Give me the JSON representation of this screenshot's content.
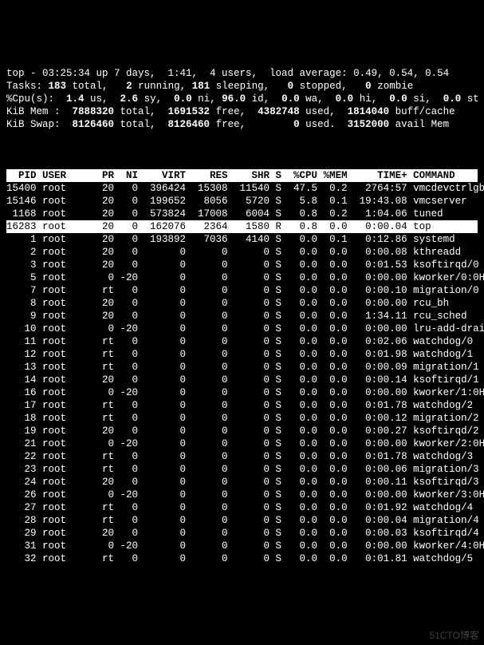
{
  "summary": {
    "line1_a": "top - 03:25:34 up 7 days,  1:41,  4 users,  load average: 0.49, 0.54, 0.54",
    "tasks_label": "Tasks:",
    "tasks_total": "183",
    "tasks_total_lbl": " total,   ",
    "tasks_running": "2",
    "tasks_running_lbl": " running, ",
    "tasks_sleeping": "181",
    "tasks_sleeping_lbl": " sleeping,   ",
    "tasks_stopped": "0",
    "tasks_stopped_lbl": " stopped,   ",
    "tasks_zombie": "0",
    "tasks_zombie_lbl": " zombie",
    "cpu_label": "%Cpu(s):  ",
    "cpu_us": "1.4",
    "cpu_us_lbl": " us,  ",
    "cpu_sy": "2.6",
    "cpu_sy_lbl": " sy,  ",
    "cpu_ni": "0.0",
    "cpu_ni_lbl": " ni, ",
    "cpu_id": "96.0",
    "cpu_id_lbl": " id,  ",
    "cpu_wa": "0.0",
    "cpu_wa_lbl": " wa,  ",
    "cpu_hi": "0.0",
    "cpu_hi_lbl": " hi,  ",
    "cpu_si": "0.0",
    "cpu_si_lbl": " si,  ",
    "cpu_st": "0.0",
    "cpu_st_lbl": " st",
    "mem_label": "KiB Mem :  ",
    "mem_total": "7888320",
    "mem_total_lbl": " total,  ",
    "mem_free": "1691532",
    "mem_free_lbl": " free,  ",
    "mem_used": "4382748",
    "mem_used_lbl": " used,  ",
    "mem_buff": "1814040",
    "mem_buff_lbl": " buff/cache",
    "swap_label": "KiB Swap:  ",
    "swap_total": "8126460",
    "swap_total_lbl": " total,  ",
    "swap_free": "8126460",
    "swap_free_lbl": " free,        ",
    "swap_used": "0",
    "swap_used_lbl": " used.  ",
    "swap_avail": "3152000",
    "swap_avail_lbl": " avail Mem"
  },
  "columns": "  PID USER      PR  NI    VIRT    RES    SHR S  %CPU %MEM     TIME+ COMMAND    ",
  "processes": [
    {
      "pid": "15400",
      "user": "root",
      "pr": "20",
      "ni": "0",
      "virt": "396424",
      "res": "15308",
      "shr": "11540",
      "s": "S",
      "cpu": "47.5",
      "mem": "0.2",
      "time": "2764:57",
      "cmd": "vmcdevctrlgb",
      "hl": false
    },
    {
      "pid": "15146",
      "user": "root",
      "pr": "20",
      "ni": "0",
      "virt": "199652",
      "res": "8056",
      "shr": "5720",
      "s": "S",
      "cpu": "5.8",
      "mem": "0.1",
      "time": "19:43.08",
      "cmd": "vmcserver",
      "hl": false
    },
    {
      "pid": "1168",
      "user": "root",
      "pr": "20",
      "ni": "0",
      "virt": "573824",
      "res": "17008",
      "shr": "6004",
      "s": "S",
      "cpu": "0.8",
      "mem": "0.2",
      "time": "1:04.06",
      "cmd": "tuned",
      "hl": false
    },
    {
      "pid": "16283",
      "user": "root",
      "pr": "20",
      "ni": "0",
      "virt": "162076",
      "res": "2364",
      "shr": "1580",
      "s": "R",
      "cpu": "0.8",
      "mem": "0.0",
      "time": "0:00.04",
      "cmd": "top",
      "hl": true
    },
    {
      "pid": "1",
      "user": "root",
      "pr": "20",
      "ni": "0",
      "virt": "193892",
      "res": "7036",
      "shr": "4140",
      "s": "S",
      "cpu": "0.0",
      "mem": "0.1",
      "time": "0:12.86",
      "cmd": "systemd",
      "hl": false
    },
    {
      "pid": "2",
      "user": "root",
      "pr": "20",
      "ni": "0",
      "virt": "0",
      "res": "0",
      "shr": "0",
      "s": "S",
      "cpu": "0.0",
      "mem": "0.0",
      "time": "0:00.08",
      "cmd": "kthreadd",
      "hl": false
    },
    {
      "pid": "3",
      "user": "root",
      "pr": "20",
      "ni": "0",
      "virt": "0",
      "res": "0",
      "shr": "0",
      "s": "S",
      "cpu": "0.0",
      "mem": "0.0",
      "time": "0:01.53",
      "cmd": "ksoftirqd/0",
      "hl": false
    },
    {
      "pid": "5",
      "user": "root",
      "pr": "0",
      "ni": "-20",
      "virt": "0",
      "res": "0",
      "shr": "0",
      "s": "S",
      "cpu": "0.0",
      "mem": "0.0",
      "time": "0:00.00",
      "cmd": "kworker/0:0H",
      "hl": false
    },
    {
      "pid": "7",
      "user": "root",
      "pr": "rt",
      "ni": "0",
      "virt": "0",
      "res": "0",
      "shr": "0",
      "s": "S",
      "cpu": "0.0",
      "mem": "0.0",
      "time": "0:00.10",
      "cmd": "migration/0",
      "hl": false
    },
    {
      "pid": "8",
      "user": "root",
      "pr": "20",
      "ni": "0",
      "virt": "0",
      "res": "0",
      "shr": "0",
      "s": "S",
      "cpu": "0.0",
      "mem": "0.0",
      "time": "0:00.00",
      "cmd": "rcu_bh",
      "hl": false
    },
    {
      "pid": "9",
      "user": "root",
      "pr": "20",
      "ni": "0",
      "virt": "0",
      "res": "0",
      "shr": "0",
      "s": "S",
      "cpu": "0.0",
      "mem": "0.0",
      "time": "1:34.11",
      "cmd": "rcu_sched",
      "hl": false
    },
    {
      "pid": "10",
      "user": "root",
      "pr": "0",
      "ni": "-20",
      "virt": "0",
      "res": "0",
      "shr": "0",
      "s": "S",
      "cpu": "0.0",
      "mem": "0.0",
      "time": "0:00.00",
      "cmd": "lru-add-drain",
      "hl": false
    },
    {
      "pid": "11",
      "user": "root",
      "pr": "rt",
      "ni": "0",
      "virt": "0",
      "res": "0",
      "shr": "0",
      "s": "S",
      "cpu": "0.0",
      "mem": "0.0",
      "time": "0:02.06",
      "cmd": "watchdog/0",
      "hl": false
    },
    {
      "pid": "12",
      "user": "root",
      "pr": "rt",
      "ni": "0",
      "virt": "0",
      "res": "0",
      "shr": "0",
      "s": "S",
      "cpu": "0.0",
      "mem": "0.0",
      "time": "0:01.98",
      "cmd": "watchdog/1",
      "hl": false
    },
    {
      "pid": "13",
      "user": "root",
      "pr": "rt",
      "ni": "0",
      "virt": "0",
      "res": "0",
      "shr": "0",
      "s": "S",
      "cpu": "0.0",
      "mem": "0.0",
      "time": "0:00.09",
      "cmd": "migration/1",
      "hl": false
    },
    {
      "pid": "14",
      "user": "root",
      "pr": "20",
      "ni": "0",
      "virt": "0",
      "res": "0",
      "shr": "0",
      "s": "S",
      "cpu": "0.0",
      "mem": "0.0",
      "time": "0:00.14",
      "cmd": "ksoftirqd/1",
      "hl": false
    },
    {
      "pid": "16",
      "user": "root",
      "pr": "0",
      "ni": "-20",
      "virt": "0",
      "res": "0",
      "shr": "0",
      "s": "S",
      "cpu": "0.0",
      "mem": "0.0",
      "time": "0:00.00",
      "cmd": "kworker/1:0H",
      "hl": false
    },
    {
      "pid": "17",
      "user": "root",
      "pr": "rt",
      "ni": "0",
      "virt": "0",
      "res": "0",
      "shr": "0",
      "s": "S",
      "cpu": "0.0",
      "mem": "0.0",
      "time": "0:01.78",
      "cmd": "watchdog/2",
      "hl": false
    },
    {
      "pid": "18",
      "user": "root",
      "pr": "rt",
      "ni": "0",
      "virt": "0",
      "res": "0",
      "shr": "0",
      "s": "S",
      "cpu": "0.0",
      "mem": "0.0",
      "time": "0:00.12",
      "cmd": "migration/2",
      "hl": false
    },
    {
      "pid": "19",
      "user": "root",
      "pr": "20",
      "ni": "0",
      "virt": "0",
      "res": "0",
      "shr": "0",
      "s": "S",
      "cpu": "0.0",
      "mem": "0.0",
      "time": "0:00.27",
      "cmd": "ksoftirqd/2",
      "hl": false
    },
    {
      "pid": "21",
      "user": "root",
      "pr": "0",
      "ni": "-20",
      "virt": "0",
      "res": "0",
      "shr": "0",
      "s": "S",
      "cpu": "0.0",
      "mem": "0.0",
      "time": "0:00.00",
      "cmd": "kworker/2:0H",
      "hl": false
    },
    {
      "pid": "22",
      "user": "root",
      "pr": "rt",
      "ni": "0",
      "virt": "0",
      "res": "0",
      "shr": "0",
      "s": "S",
      "cpu": "0.0",
      "mem": "0.0",
      "time": "0:01.78",
      "cmd": "watchdog/3",
      "hl": false
    },
    {
      "pid": "23",
      "user": "root",
      "pr": "rt",
      "ni": "0",
      "virt": "0",
      "res": "0",
      "shr": "0",
      "s": "S",
      "cpu": "0.0",
      "mem": "0.0",
      "time": "0:00.06",
      "cmd": "migration/3",
      "hl": false
    },
    {
      "pid": "24",
      "user": "root",
      "pr": "20",
      "ni": "0",
      "virt": "0",
      "res": "0",
      "shr": "0",
      "s": "S",
      "cpu": "0.0",
      "mem": "0.0",
      "time": "0:00.11",
      "cmd": "ksoftirqd/3",
      "hl": false
    },
    {
      "pid": "26",
      "user": "root",
      "pr": "0",
      "ni": "-20",
      "virt": "0",
      "res": "0",
      "shr": "0",
      "s": "S",
      "cpu": "0.0",
      "mem": "0.0",
      "time": "0:00.00",
      "cmd": "kworker/3:0H",
      "hl": false
    },
    {
      "pid": "27",
      "user": "root",
      "pr": "rt",
      "ni": "0",
      "virt": "0",
      "res": "0",
      "shr": "0",
      "s": "S",
      "cpu": "0.0",
      "mem": "0.0",
      "time": "0:01.92",
      "cmd": "watchdog/4",
      "hl": false
    },
    {
      "pid": "28",
      "user": "root",
      "pr": "rt",
      "ni": "0",
      "virt": "0",
      "res": "0",
      "shr": "0",
      "s": "S",
      "cpu": "0.0",
      "mem": "0.0",
      "time": "0:00.04",
      "cmd": "migration/4",
      "hl": false
    },
    {
      "pid": "29",
      "user": "root",
      "pr": "20",
      "ni": "0",
      "virt": "0",
      "res": "0",
      "shr": "0",
      "s": "S",
      "cpu": "0.0",
      "mem": "0.0",
      "time": "0:00.03",
      "cmd": "ksoftirqd/4",
      "hl": false
    },
    {
      "pid": "31",
      "user": "root",
      "pr": "0",
      "ni": "-20",
      "virt": "0",
      "res": "0",
      "shr": "0",
      "s": "S",
      "cpu": "0.0",
      "mem": "0.0",
      "time": "0:00.00",
      "cmd": "kworker/4:0H",
      "hl": false
    },
    {
      "pid": "32",
      "user": "root",
      "pr": "rt",
      "ni": "0",
      "virt": "0",
      "res": "0",
      "shr": "0",
      "s": "S",
      "cpu": "0.0",
      "mem": "0.0",
      "time": "0:01.81",
      "cmd": "watchdog/5",
      "hl": false
    }
  ],
  "watermark": "51CTO博客"
}
